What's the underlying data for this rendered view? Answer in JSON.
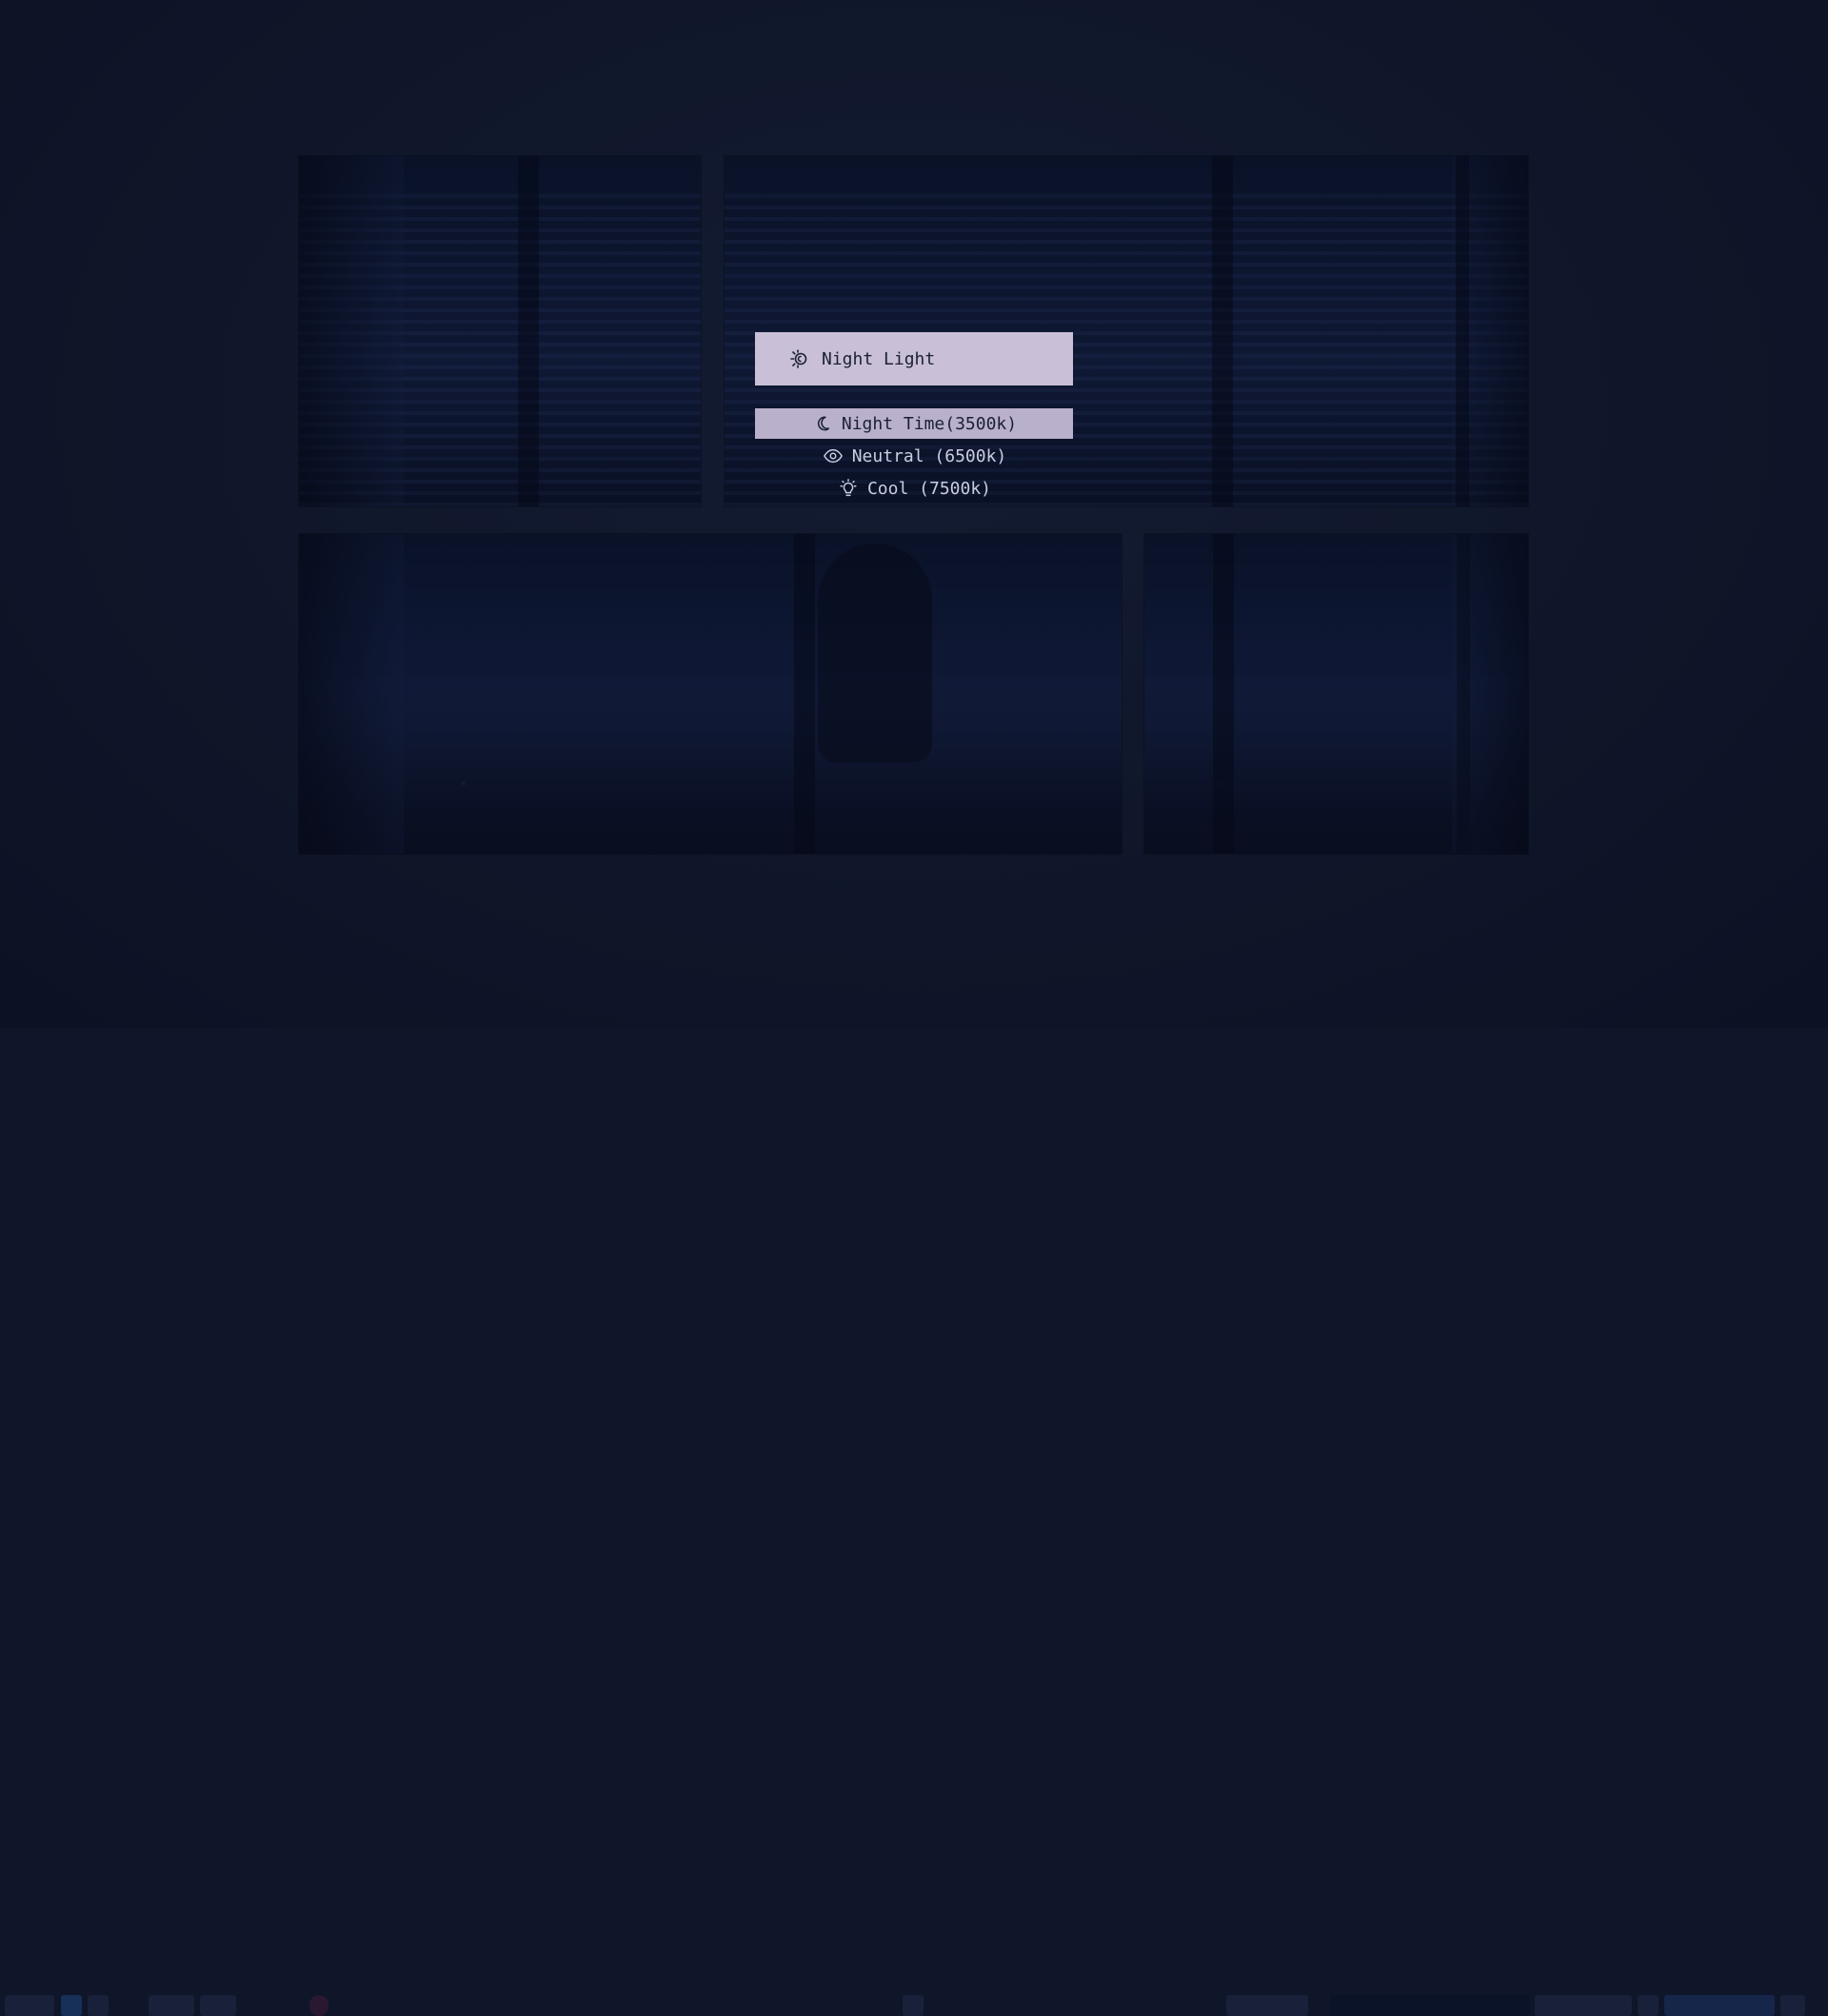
{
  "menu": {
    "title": "Night Light",
    "title_icon": "night-light-icon",
    "options": [
      {
        "label": "Night Time(3500k)",
        "icon": "moon-icon",
        "selected": true
      },
      {
        "label": "Neutral (6500k)",
        "icon": "eye-icon",
        "selected": false
      },
      {
        "label": "Cool (7500k)",
        "icon": "bulb-icon",
        "selected": false
      }
    ]
  },
  "colors": {
    "background": "#0f1629",
    "title_bg": "#c9bfd6",
    "selected_bg": "#b9b0cc",
    "text_dark": "#1b2036",
    "text_light": "#c9cde0"
  }
}
